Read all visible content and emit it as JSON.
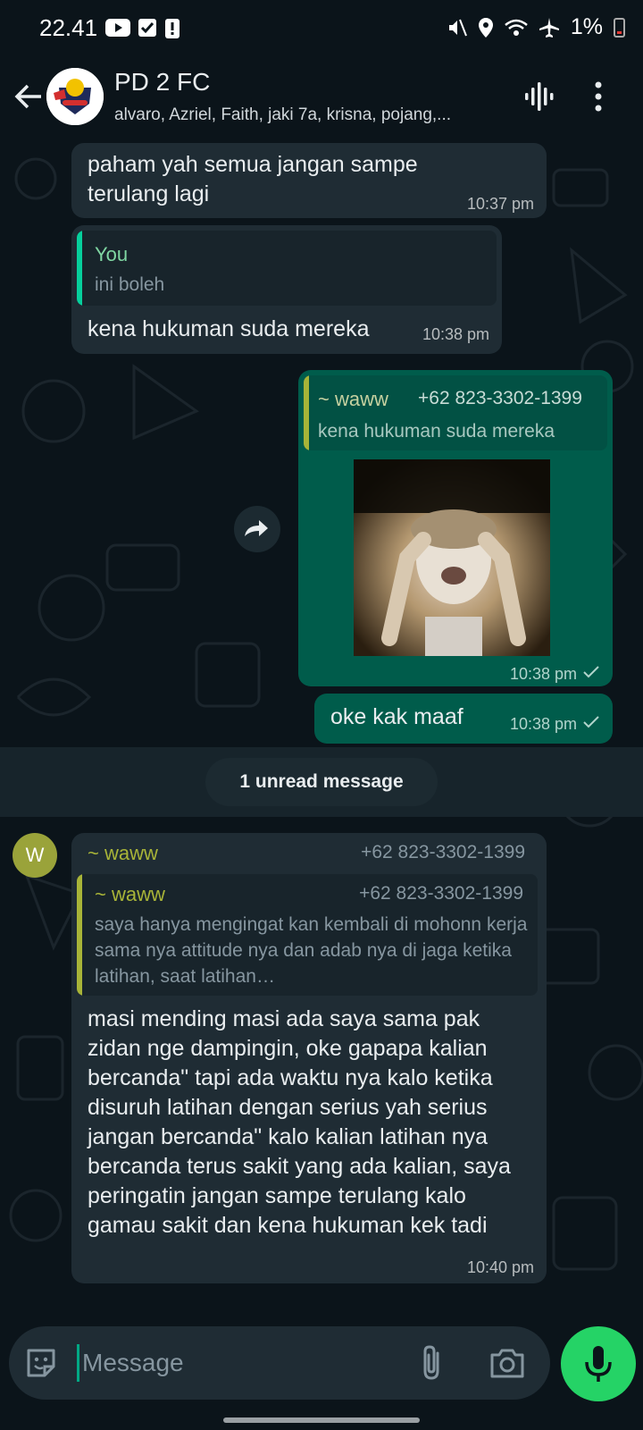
{
  "status_bar": {
    "time": "22.41",
    "battery": "1%"
  },
  "header": {
    "title": "PD 2 FC",
    "subtitle": "alvaro, Azriel, Faith, jaki 7a, krisna, pojang,..."
  },
  "messages": [
    {
      "direction": "incoming",
      "text": "paham yah semua jangan sampe terulang lagi",
      "time": "10:37 pm"
    },
    {
      "direction": "incoming",
      "quote": {
        "name": "You",
        "text": "ini boleh"
      },
      "text": "kena hukuman suda mereka",
      "time": "10:38 pm"
    },
    {
      "direction": "outgoing",
      "quote": {
        "name": "~ waww",
        "number": "+62 823-3302-1399",
        "text": "kena hukuman suda mereka"
      },
      "media": "image",
      "time": "10:38 pm"
    },
    {
      "direction": "outgoing",
      "text": "oke kak maaf",
      "time": "10:38 pm"
    },
    {
      "direction": "incoming",
      "sender_initial": "W",
      "sender_name": "~ waww",
      "sender_number": "+62 823-3302-1399",
      "quote": {
        "name": "~ waww",
        "number": "+62 823-3302-1399",
        "text": "saya hanya mengingat kan kembali di mohonn kerja sama nya attitude nya dan adab nya di jaga ketika latihan, saat latihan…"
      },
      "text": "masi mending masi ada saya sama pak zidan nge dampingin, oke gapapa kalian bercanda\" tapi ada waktu nya kalo ketika disuruh latihan dengan serius yah serius jangan bercanda\" kalo kalian latihan nya bercanda terus sakit yang ada kalian, saya peringatin jangan sampe terulang kalo gamau sakit dan kena hukuman kek tadi",
      "time": "10:40 pm"
    }
  ],
  "unread_divider": "1 unread message",
  "input": {
    "placeholder": "Message",
    "value": ""
  },
  "colors": {
    "background": "#0b141a",
    "incoming_bubble": "#1f2c34",
    "outgoing_bubble": "#005c4b",
    "accent": "#25d366",
    "you_name": "#7fd6a2",
    "waww_name": "#a8b438"
  },
  "icons": [
    "back-arrow-icon",
    "group-avatar",
    "voice-call-icon",
    "more-options-icon",
    "forward-icon",
    "read-check-icon",
    "emoji-icon",
    "attach-icon",
    "camera-icon",
    "mic-icon"
  ]
}
